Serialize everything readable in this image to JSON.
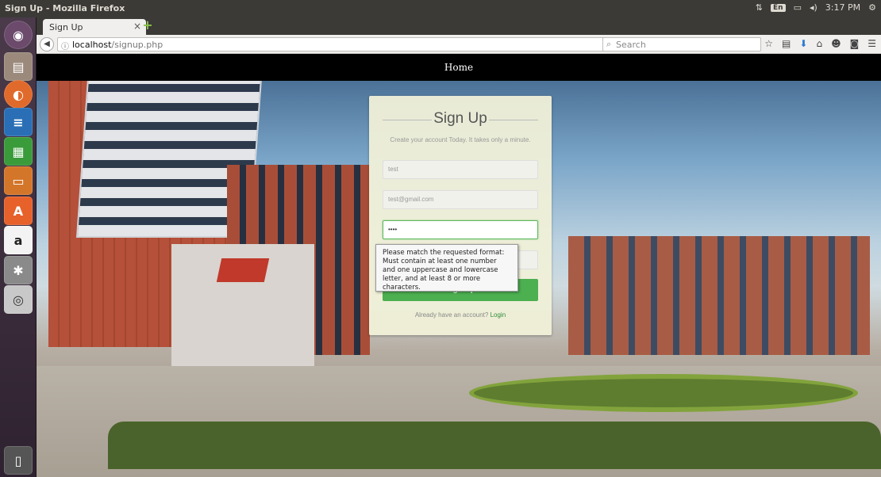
{
  "window": {
    "title": "Sign Up - Mozilla Firefox"
  },
  "tray": {
    "keyboard": "En",
    "time": "3:17 PM"
  },
  "browser": {
    "tab_label": "Sign Up",
    "tab_close": "×",
    "new_tab": "+",
    "url_host": "localhost",
    "url_path": "/signup.php",
    "search_placeholder": "Search"
  },
  "launcher": {
    "items": [
      "ubuntu-logo",
      "files",
      "firefox",
      "writer",
      "calc",
      "impress",
      "software-center",
      "amazon",
      "settings",
      "camera",
      "trash"
    ]
  },
  "page": {
    "nav_home": "Home",
    "signup": {
      "title": "Sign Up",
      "subtitle": "Create your account Today. It takes only a minute.",
      "username_value": "test",
      "email_value": "test@gmail.com",
      "password_value": "••••",
      "button_label": "Sign Up",
      "login_prompt": "Already have an account?",
      "login_link": "Login"
    },
    "tooltip": "Please match the requested format: Must contain at least one number and one uppercase and lowercase letter, and at least 8 or more characters."
  }
}
